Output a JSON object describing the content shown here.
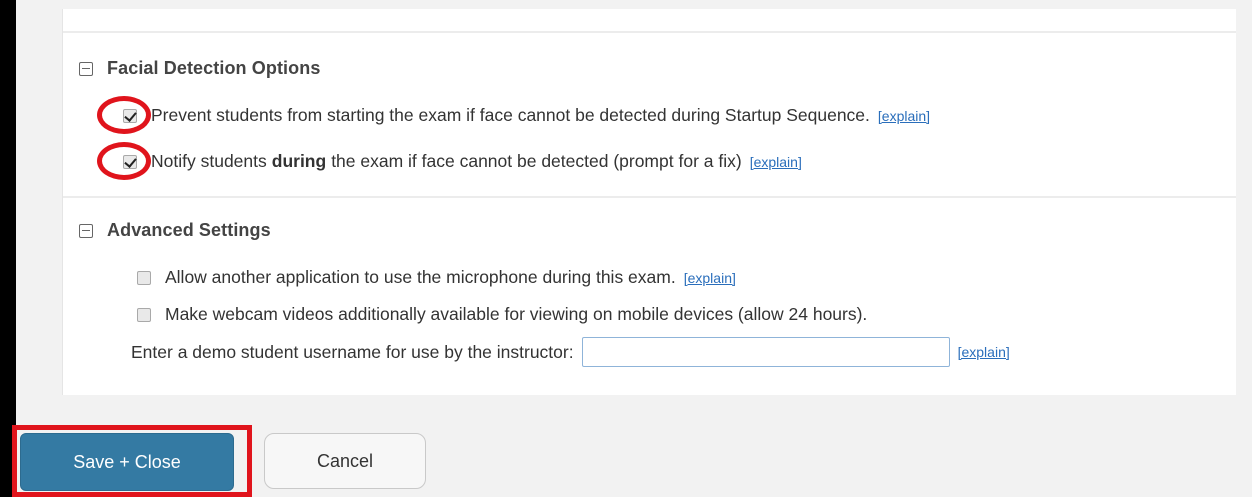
{
  "facial_detection": {
    "title": "Facial Detection Options",
    "options": [
      {
        "text": "Prevent students from starting the exam if face cannot be detected during Startup Sequence.",
        "checked": true,
        "link": "[explain]"
      },
      {
        "text_before": "Notify students",
        "text_bold": "during",
        "text_after": "the exam if face cannot be detected (prompt for a fix)",
        "checked": true,
        "link": "[explain]"
      }
    ]
  },
  "advanced_settings": {
    "title": "Advanced Settings",
    "options": [
      {
        "text": "Allow another application to use the microphone during this exam.",
        "checked": false,
        "link": "[explain]"
      },
      {
        "text": "Make webcam videos additionally available for viewing on mobile devices (allow 24 hours).",
        "checked": false
      }
    ],
    "demo_username": {
      "label": "Enter a demo student username for use by the instructor:",
      "value": "",
      "link": "[explain]"
    }
  },
  "footer": {
    "save_label": "Save + Close",
    "cancel_label": "Cancel"
  },
  "colors": {
    "primary_button": "#347aa3",
    "link": "#2a6ebb",
    "annotation": "#e0141c"
  },
  "icons": [
    "collapse-icon",
    "checkbox-checked",
    "checkbox-unchecked"
  ]
}
